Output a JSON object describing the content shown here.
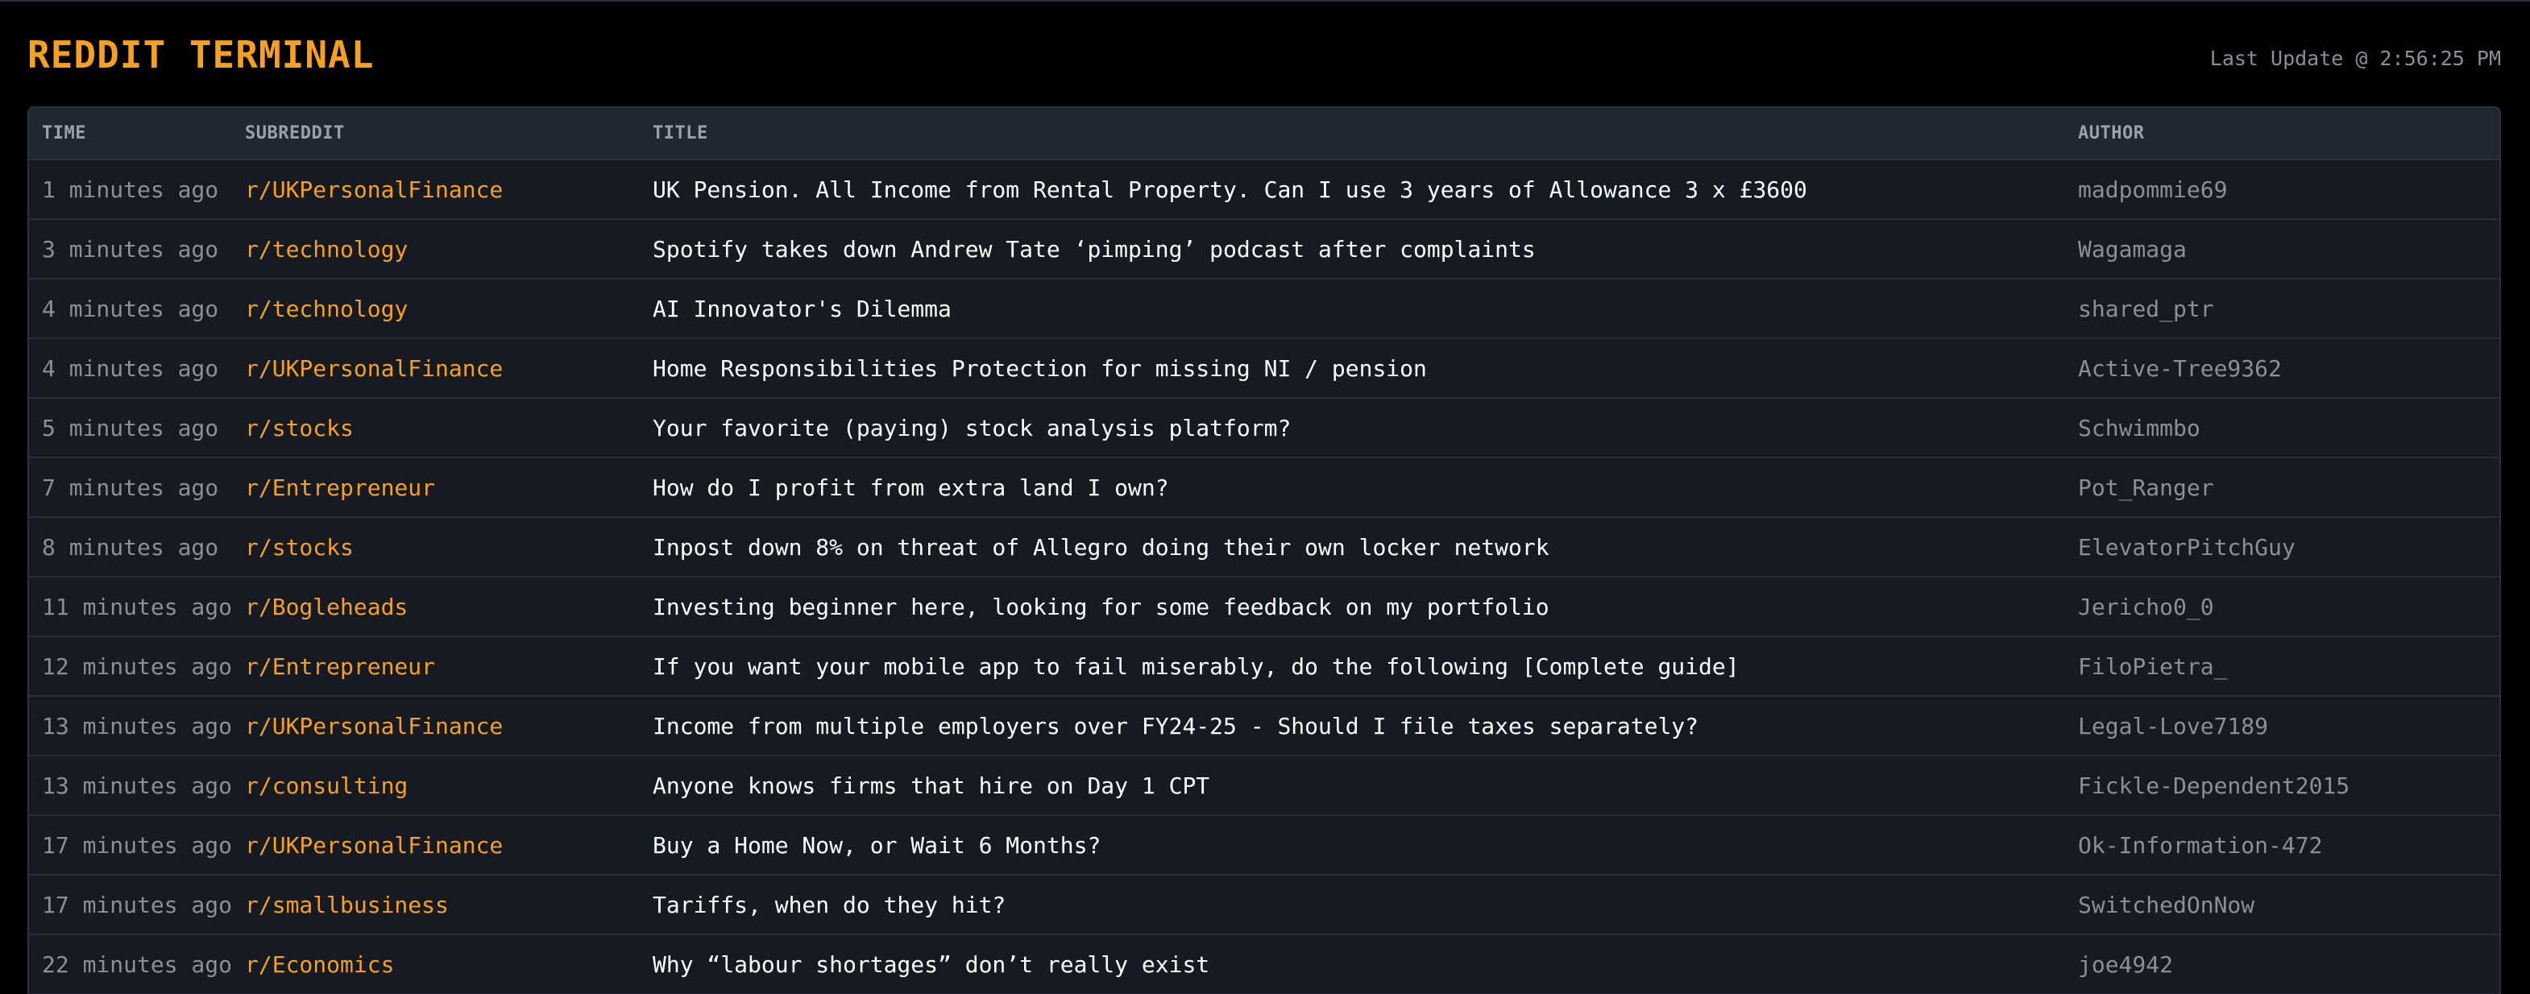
{
  "header": {
    "title": "REDDIT TERMINAL",
    "last_update": "Last Update @ 2:56:25 PM"
  },
  "table": {
    "columns": [
      "TIME",
      "SUBREDDIT",
      "TITLE",
      "AUTHOR"
    ],
    "rows": [
      {
        "time": "1 minutes ago",
        "subreddit": "r/UKPersonalFinance",
        "title": "UK Pension. All Income from Rental Property. Can I use 3 years of Allowance 3 x £3600",
        "author": "madpommie69"
      },
      {
        "time": "3 minutes ago",
        "subreddit": "r/technology",
        "title": "Spotify takes down Andrew Tate ‘pimping’ podcast after complaints",
        "author": "Wagamaga"
      },
      {
        "time": "4 minutes ago",
        "subreddit": "r/technology",
        "title": "AI Innovator's Dilemma",
        "author": "shared_ptr"
      },
      {
        "time": "4 minutes ago",
        "subreddit": "r/UKPersonalFinance",
        "title": "Home Responsibilities Protection for missing NI / pension",
        "author": "Active-Tree9362"
      },
      {
        "time": "5 minutes ago",
        "subreddit": "r/stocks",
        "title": "Your favorite (paying) stock analysis platform?",
        "author": "Schwimmbo"
      },
      {
        "time": "7 minutes ago",
        "subreddit": "r/Entrepreneur",
        "title": "How do I profit from extra land I own?",
        "author": "Pot_Ranger"
      },
      {
        "time": "8 minutes ago",
        "subreddit": "r/stocks",
        "title": "Inpost down 8% on threat of Allegro doing their own locker network",
        "author": "ElevatorPitchGuy"
      },
      {
        "time": "11 minutes ago",
        "subreddit": "r/Bogleheads",
        "title": "Investing beginner here, looking for some feedback on my portfolio",
        "author": "Jericho0_0"
      },
      {
        "time": "12 minutes ago",
        "subreddit": "r/Entrepreneur",
        "title": "If you want your mobile app to fail miserably, do the following [Complete guide]",
        "author": "FiloPietra_"
      },
      {
        "time": "13 minutes ago",
        "subreddit": "r/UKPersonalFinance",
        "title": "Income from multiple employers over FY24-25 - Should I file taxes separately?",
        "author": "Legal-Love7189"
      },
      {
        "time": "13 minutes ago",
        "subreddit": "r/consulting",
        "title": "Anyone knows firms that hire on Day 1 CPT",
        "author": "Fickle-Dependent2015"
      },
      {
        "time": "17 minutes ago",
        "subreddit": "r/UKPersonalFinance",
        "title": "Buy a Home Now, or Wait 6 Months?",
        "author": "Ok-Information-472"
      },
      {
        "time": "17 minutes ago",
        "subreddit": "r/smallbusiness",
        "title": "Tariffs, when do they hit?",
        "author": "SwitchedOnNow"
      },
      {
        "time": "22 minutes ago",
        "subreddit": "r/Economics",
        "title": "Why “labour shortages” don’t really exist",
        "author": "joe4942"
      }
    ]
  },
  "colors": {
    "accent": "#f5a020",
    "background": "#000000",
    "table_bg": "#151a23",
    "muted_text": "#8a8f98",
    "title_text": "#ffffff"
  }
}
